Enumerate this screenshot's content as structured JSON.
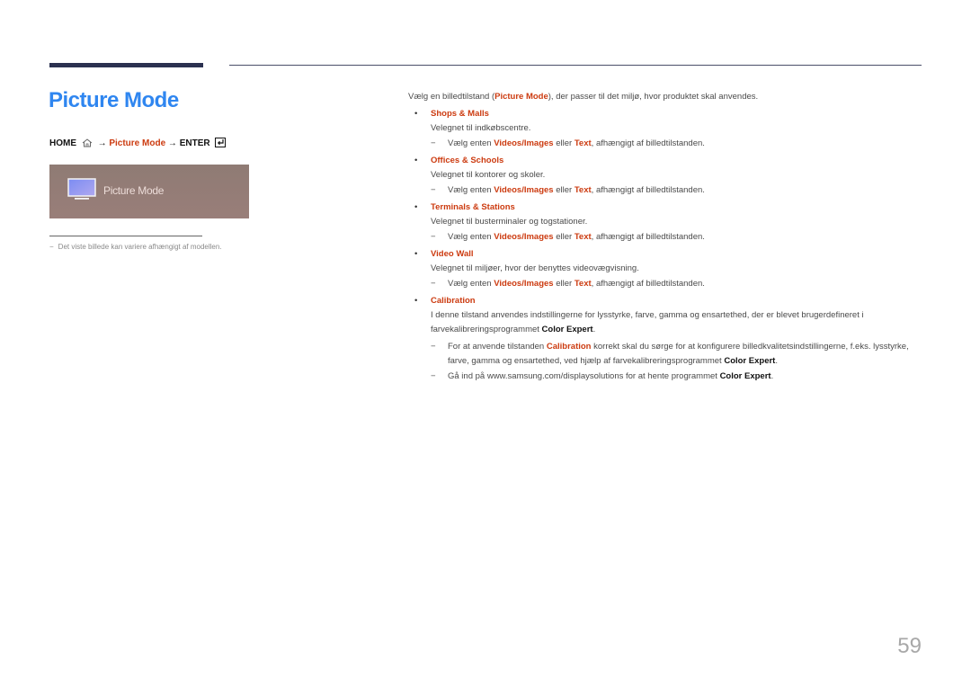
{
  "header": {
    "title": "Picture Mode"
  },
  "path": {
    "home": "HOME",
    "arrow1": "→",
    "menu": "Picture Mode",
    "arrow2": "→",
    "enter": "ENTER"
  },
  "panel": {
    "label": "Picture Mode"
  },
  "note": {
    "dash": "−",
    "text": "Det viste billede kan variere afhængigt af modellen."
  },
  "content": {
    "intro_before": "Vælg en billedtilstand (",
    "intro_highlight": "Picture Mode",
    "intro_after": "), der passer til det miljø, hvor produktet skal anvendes.",
    "bullet": "•",
    "dash": "−",
    "sub_common": {
      "before": "Vælg enten ",
      "opt1": "Videos/Images",
      "mid": " eller ",
      "opt2": "Text",
      "after": ", afhængigt af billedtilstanden."
    },
    "items": [
      {
        "title": "Shops & Malls",
        "desc": "Velegnet til indkøbscentre."
      },
      {
        "title": "Offices & Schools",
        "desc": "Velegnet til kontorer og skoler."
      },
      {
        "title": "Terminals & Stations",
        "desc": "Velegnet til busterminaler og togstationer."
      },
      {
        "title": "Video Wall",
        "desc": "Velegnet til miljøer, hvor der benyttes videovægvisning."
      },
      {
        "title": "Calibration",
        "desc_before": "I denne tilstand anvendes indstillingerne for lysstyrke, farve, gamma og ensartethed, der er blevet brugerdefineret i farvekalibreringsprogrammet ",
        "desc_bold": "Color Expert",
        "desc_after": "."
      }
    ],
    "calibration_notes": [
      {
        "before": "For at anvende tilstanden ",
        "red": "Calibration",
        "middle": " korrekt skal du sørge for at konfigurere billedkvalitetsindstillingerne, f.eks. lysstyrke, farve, gamma og ensartethed, ved hjælp af farvekalibreringsprogrammet ",
        "bold": "Color Expert",
        "after": "."
      },
      {
        "before": "Gå ind på www.samsung.com/displaysolutions for at hente programmet ",
        "bold": "Color Expert",
        "after": "."
      }
    ]
  },
  "footer": {
    "page_number": "59"
  },
  "colors": {
    "title_blue": "#2f86f0",
    "accent_red": "#cc3b10",
    "top_bar": "#2b3150"
  }
}
